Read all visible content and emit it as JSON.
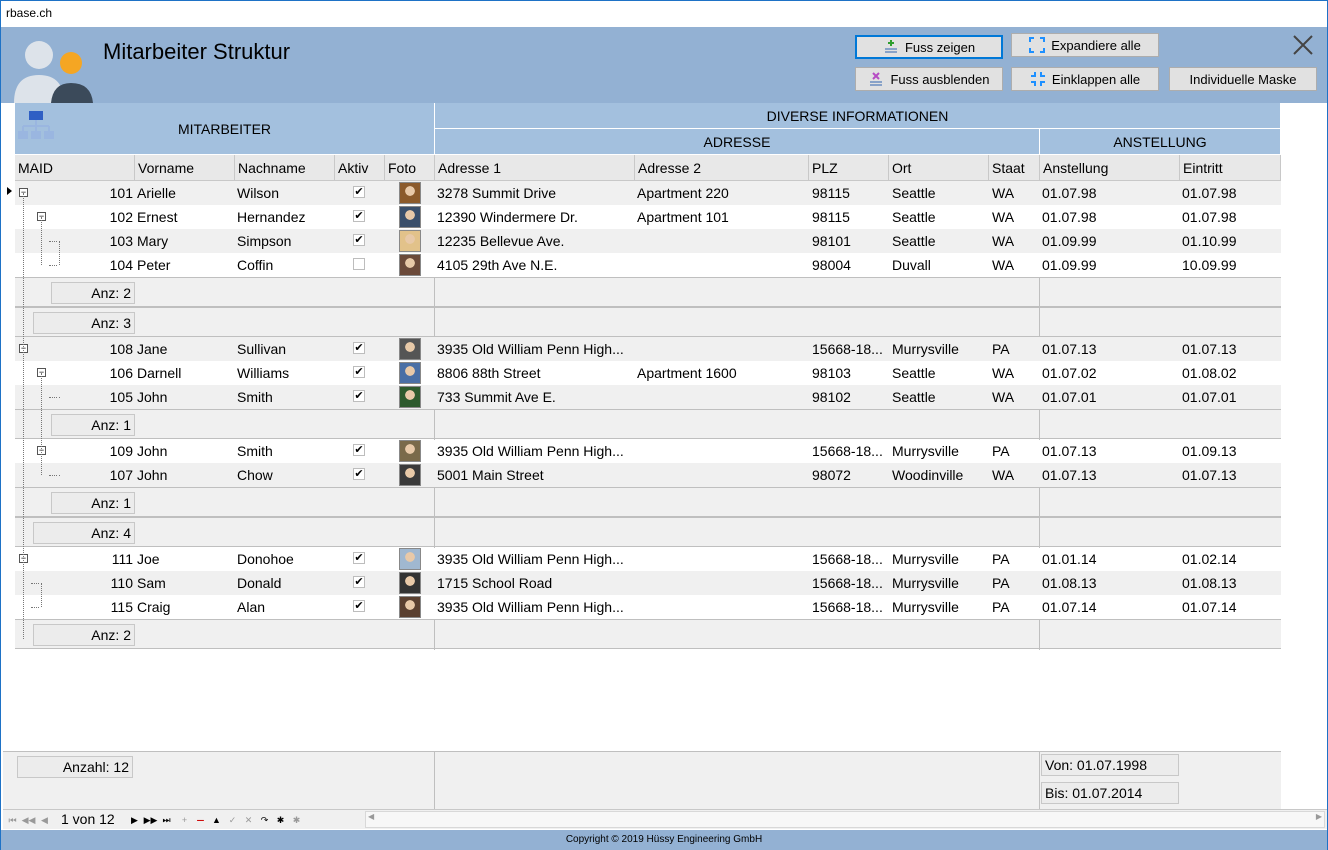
{
  "window": {
    "title": "rbase.ch"
  },
  "header": {
    "title": "Mitarbeiter Struktur",
    "buttons": {
      "fuss_zeigen": "Fuss zeigen",
      "fuss_ausblenden": "Fuss ausblenden",
      "expandiere_alle": "Expandiere alle",
      "einklappen_alle": "Einklappen alle",
      "individuelle_maske": "Individuelle Maske"
    }
  },
  "grid": {
    "bands": {
      "mitarbeiter": "MITARBEITER",
      "diverse": "DIVERSE INFORMATIONEN",
      "adresse": "ADRESSE",
      "anstellung": "ANSTELLUNG"
    },
    "columns": {
      "maid": "MAID",
      "vorname": "Vorname",
      "nachname": "Nachname",
      "aktiv": "Aktiv",
      "foto": "Foto",
      "adresse1": "Adresse 1",
      "adresse2": "Adresse 2",
      "plz": "PLZ",
      "ort": "Ort",
      "staat": "Staat",
      "anstellung": "Anstellung",
      "eintritt": "Eintritt"
    },
    "rows": [
      {
        "maid": "101",
        "vorname": "Arielle",
        "nachname": "Wilson",
        "aktiv": true,
        "adresse1": "3278 Summit Drive",
        "adresse2": "Apartment 220",
        "plz": "98115",
        "ort": "Seattle",
        "staat": "WA",
        "anstellung": "01.07.98",
        "eintritt": "01.07.98"
      },
      {
        "maid": "102",
        "vorname": "Ernest",
        "nachname": "Hernandez",
        "aktiv": true,
        "adresse1": "12390 Windermere Dr.",
        "adresse2": "Apartment 101",
        "plz": "98115",
        "ort": "Seattle",
        "staat": "WA",
        "anstellung": "01.07.98",
        "eintritt": "01.07.98"
      },
      {
        "maid": "103",
        "vorname": "Mary",
        "nachname": "Simpson",
        "aktiv": true,
        "adresse1": "12235 Bellevue Ave.",
        "adresse2": "",
        "plz": "98101",
        "ort": "Seattle",
        "staat": "WA",
        "anstellung": "01.09.99",
        "eintritt": "01.10.99"
      },
      {
        "maid": "104",
        "vorname": "Peter",
        "nachname": "Coffin",
        "aktiv": false,
        "adresse1": "4105 29th Ave N.E.",
        "adresse2": "",
        "plz": "98004",
        "ort": "Duvall",
        "staat": "WA",
        "anstellung": "01.09.99",
        "eintritt": "10.09.99"
      },
      {
        "maid": "108",
        "vorname": "Jane",
        "nachname": "Sullivan",
        "aktiv": true,
        "adresse1": "3935 Old William Penn High...",
        "adresse2": "",
        "plz": "15668-18...",
        "ort": "Murrysville",
        "staat": "PA",
        "anstellung": "01.07.13",
        "eintritt": "01.07.13"
      },
      {
        "maid": "106",
        "vorname": "Darnell",
        "nachname": "Williams",
        "aktiv": true,
        "adresse1": "8806 88th Street",
        "adresse2": "Apartment 1600",
        "plz": "98103",
        "ort": "Seattle",
        "staat": "WA",
        "anstellung": "01.07.02",
        "eintritt": "01.08.02"
      },
      {
        "maid": "105",
        "vorname": "John",
        "nachname": "Smith",
        "aktiv": true,
        "adresse1": "733 Summit Ave E.",
        "adresse2": "",
        "plz": "98102",
        "ort": "Seattle",
        "staat": "WA",
        "anstellung": "01.07.01",
        "eintritt": "01.07.01"
      },
      {
        "maid": "109",
        "vorname": "John",
        "nachname": "Smith",
        "aktiv": true,
        "adresse1": "3935 Old William Penn High...",
        "adresse2": "",
        "plz": "15668-18...",
        "ort": "Murrysville",
        "staat": "PA",
        "anstellung": "01.07.13",
        "eintritt": "01.09.13"
      },
      {
        "maid": "107",
        "vorname": "John",
        "nachname": "Chow",
        "aktiv": true,
        "adresse1": "5001 Main Street",
        "adresse2": "",
        "plz": "98072",
        "ort": "Woodinville",
        "staat": "WA",
        "anstellung": "01.07.13",
        "eintritt": "01.07.13"
      },
      {
        "maid": "111",
        "vorname": "Joe",
        "nachname": "Donohoe",
        "aktiv": true,
        "adresse1": "3935 Old William Penn High...",
        "adresse2": "",
        "plz": "15668-18...",
        "ort": "Murrysville",
        "staat": "PA",
        "anstellung": "01.01.14",
        "eintritt": "01.02.14"
      },
      {
        "maid": "110",
        "vorname": "Sam",
        "nachname": "Donald",
        "aktiv": true,
        "adresse1": "1715 School Road",
        "adresse2": "",
        "plz": "15668-18...",
        "ort": "Murrysville",
        "staat": "PA",
        "anstellung": "01.08.13",
        "eintritt": "01.08.13"
      },
      {
        "maid": "115",
        "vorname": "Craig",
        "nachname": "Alan",
        "aktiv": true,
        "adresse1": "3935 Old William Penn High...",
        "adresse2": "",
        "plz": "15668-18...",
        "ort": "Murrysville",
        "staat": "PA",
        "anstellung": "01.07.14",
        "eintritt": "01.07.14"
      }
    ],
    "footers": [
      "Anz: 2",
      "Anz: 3",
      "Anz: 1",
      "Anz: 1",
      "Anz: 4",
      "Anz: 2"
    ],
    "summary": {
      "anzahl": "Anzahl: 12",
      "von": "Von: 01.07.1998",
      "bis": "Bis: 01.07.2014"
    }
  },
  "navigator": {
    "position": "1 von 12"
  },
  "status": {
    "copyright": "Copyright © 2019 Hüssy Engineering GmbH"
  },
  "colors": {
    "header_bg": "#93b1d3",
    "band_bg": "#a3c0de",
    "accent": "#0078d7"
  }
}
